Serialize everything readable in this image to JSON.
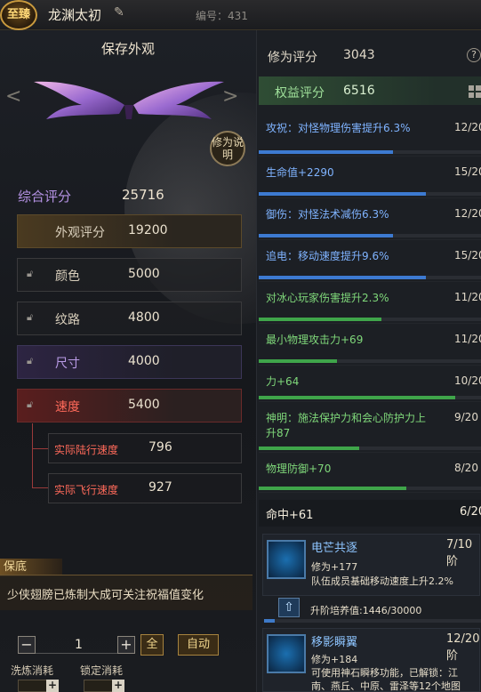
{
  "top": {
    "badge": "至臻",
    "wing_name": "龙渊太初",
    "serial": "编号：431"
  },
  "left": {
    "save_title": "保存外观",
    "explain": "修为说明",
    "overall_label": "综合评分",
    "overall_value": "25716",
    "rows": [
      {
        "label": "外观评分",
        "value": "19200"
      },
      {
        "label": "颜色",
        "value": "5000"
      },
      {
        "label": "纹路",
        "value": "4800"
      },
      {
        "label": "尺寸",
        "value": "4000"
      },
      {
        "label": "速度",
        "value": "5400"
      }
    ],
    "subrows": [
      {
        "label": "实际陆行速度",
        "value": "796"
      },
      {
        "label": "实际飞行速度",
        "value": "927"
      }
    ],
    "bless_tag": "保底",
    "bless_text": "少侠翅膀已炼制大成可关注祝福值变化",
    "quantity": "1",
    "all_label": "全",
    "auto_label": "自动",
    "cost_wash": "洗炼消耗",
    "cost_lock": "锁定消耗"
  },
  "right": {
    "xiuwei_label": "修为评分",
    "xiuwei_value": "3043",
    "quanyi_label": "权益评分",
    "quanyi_value": "6516",
    "attrs": [
      {
        "text": "攻祝：对怪物理伤害提升6.3%",
        "count": "12/20",
        "progress": 0.6,
        "color": "#7fb3ff",
        "bar": "#3d7ad1"
      },
      {
        "text": "生命值+2290",
        "count": "15/20",
        "progress": 0.75,
        "color": "#7fb3ff",
        "bar": "#3d7ad1"
      },
      {
        "text": "御伤：对怪法术减伤6.3%",
        "count": "12/20",
        "progress": 0.6,
        "color": "#7fb3ff",
        "bar": "#3d7ad1"
      },
      {
        "text": "追电：移动速度提升9.6%",
        "count": "15/20",
        "progress": 0.75,
        "color": "#7fb3ff",
        "bar": "#3d7ad1"
      },
      {
        "text": "对冰心玩家伤害提升2.3%",
        "count": "11/20",
        "progress": 0.55,
        "color": "#7fd87a",
        "bar": "#3fa54a"
      },
      {
        "text": "最小物理攻击力+69",
        "count": "11/20",
        "progress": 0.35,
        "color": "#7fd87a",
        "bar": "#3fa54a"
      },
      {
        "text": "力+64",
        "count": "10/20",
        "progress": 0.88,
        "color": "#7fd87a",
        "bar": "#3fa54a"
      },
      {
        "text": "神明：施法保护力和会心防护力上升87",
        "count": "9/20",
        "progress": 0.45,
        "color": "#7fd87a",
        "bar": "#3fa54a"
      },
      {
        "text": "物理防御+70",
        "count": "8/20",
        "progress": 0.66,
        "color": "#7fd87a",
        "bar": "#3fa54a"
      }
    ],
    "mingzhong": {
      "text": "命中+61",
      "count": "6/20"
    },
    "skills": [
      {
        "name": "电芒共逐",
        "level": "7/10阶",
        "line1": "修为+177",
        "line2": "队伍成员基础移动速度上升2.2%"
      },
      {
        "name": "移影瞬翼",
        "level": "12/20阶",
        "line1": "修为+184",
        "line2": "可使用神石瞬移功能，已解锁：江",
        "line3": "南、燕丘、中原、雷泽等12个地图"
      }
    ],
    "train_label": "升阶培养值:1446/30000",
    "train_progress": 0.048
  }
}
